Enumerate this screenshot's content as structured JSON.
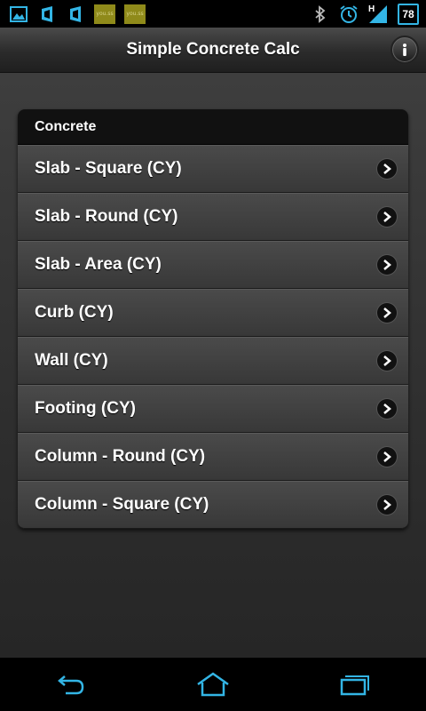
{
  "status_bar": {
    "left_icons": [
      "gallery-icon",
      "signal-app-icon",
      "signal-app-icon",
      "app-chip-icon",
      "app-chip-icon"
    ],
    "chip_text": "you.ss",
    "network_type": "H",
    "battery_level": "78",
    "accent_color": "#33b5e5"
  },
  "title_bar": {
    "title": "Simple Concrete Calc",
    "info_icon": "info-icon"
  },
  "group": {
    "header": "Concrete",
    "items": [
      {
        "label": "Slab - Square (CY)"
      },
      {
        "label": "Slab - Round (CY)"
      },
      {
        "label": "Slab - Area (CY)"
      },
      {
        "label": "Curb (CY)"
      },
      {
        "label": "Wall (CY)"
      },
      {
        "label": "Footing (CY)"
      },
      {
        "label": "Column - Round (CY)"
      },
      {
        "label": "Column - Square (CY)"
      }
    ]
  },
  "nav_bar": {
    "buttons": [
      "back-icon",
      "home-icon",
      "recent-apps-icon"
    ],
    "color": "#33b5e5"
  }
}
